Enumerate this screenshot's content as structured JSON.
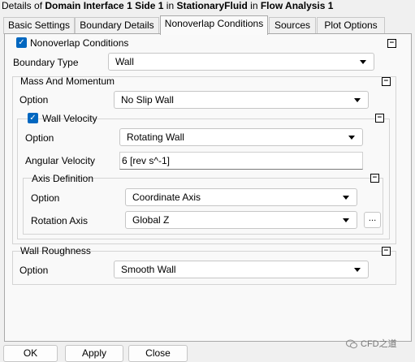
{
  "window": {
    "prefix": "Details of",
    "object": "Domain Interface 1 Side 1",
    "in1": "in",
    "parent": "StationaryFluid",
    "in2": "in",
    "analysis": "Flow Analysis 1"
  },
  "tabs": [
    {
      "label": "Basic Settings"
    },
    {
      "label": "Boundary Details"
    },
    {
      "label": "Nonoverlap Conditions",
      "active": true
    },
    {
      "label": "Sources"
    },
    {
      "label": "Plot Options"
    }
  ],
  "nonoverlap": {
    "label": "Nonoverlap Conditions",
    "checked": true,
    "boundary_type_label": "Boundary Type",
    "boundary_type_value": "Wall"
  },
  "mass": {
    "title": "Mass And Momentum",
    "option_label": "Option",
    "option_value": "No Slip Wall"
  },
  "wall_velocity": {
    "label": "Wall Velocity",
    "checked": true,
    "option_label": "Option",
    "option_value": "Rotating Wall",
    "angular_label": "Angular Velocity",
    "angular_value": "6 [rev s^-1]"
  },
  "axis": {
    "title": "Axis Definition",
    "option_label": "Option",
    "option_value": "Coordinate Axis",
    "rotation_label": "Rotation Axis",
    "rotation_value": "Global Z",
    "browse_label": "..."
  },
  "roughness": {
    "title": "Wall Roughness",
    "option_label": "Option",
    "option_value": "Smooth Wall"
  },
  "collapse_label": "−",
  "buttons": {
    "ok": "OK",
    "apply": "Apply",
    "close": "Close"
  },
  "watermark": "CFD之道",
  "icons": {
    "checkbox": "checkmark-icon",
    "collapse": "minus-box-icon",
    "dropdown": "chevron-down-icon",
    "watermark": "wechat-icon"
  },
  "colors": {
    "accent": "#0067c0",
    "panel": "#f9f9f9",
    "window": "#f0f0f0"
  }
}
